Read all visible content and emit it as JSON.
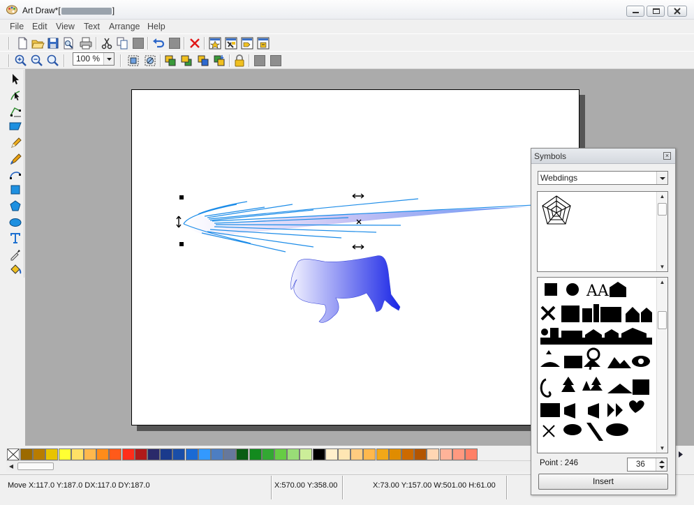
{
  "window": {
    "title": "Art Draw*[",
    "title_suffix": "]",
    "controls": [
      "minimize",
      "maximize",
      "close"
    ]
  },
  "menu": [
    "File",
    "Edit",
    "View",
    "Text",
    "Arrange",
    "Help"
  ],
  "toolbar1": {
    "buttons": [
      "new-icon",
      "open-icon",
      "save-icon",
      "print-preview-icon",
      "print-icon",
      "cut-icon",
      "copy-icon",
      "paste-icon",
      "undo-icon",
      "redo-icon",
      "delete-icon",
      "symbol-a-icon",
      "symbol-b-icon",
      "symbol-c-icon",
      "symbol-d-icon"
    ]
  },
  "toolbar2": {
    "buttons": [
      "zoom-in-icon",
      "zoom-out-icon",
      "zoom-actual-icon"
    ],
    "zoom_value": "100 %",
    "arrange_buttons": [
      "group-icon",
      "ungroup-icon",
      "bring-front-icon",
      "send-back-icon",
      "bring-forward-icon",
      "send-backward-icon",
      "lock-icon",
      "align-a-icon",
      "align-b-icon"
    ]
  },
  "tools": [
    "pointer-tool",
    "node-edit-tool",
    "crop-tool",
    "parallelogram-tool",
    "pencil-tool",
    "pen-tool",
    "bezier-tool",
    "rectangle-tool",
    "polygon-tool",
    "ellipse-tool",
    "text-tool",
    "color-picker-tool",
    "paint-bucket-tool"
  ],
  "palette": {
    "colors": [
      "#9c6a00",
      "#b87c00",
      "#e8c400",
      "#ffff33",
      "#ffe066",
      "#ffb84d",
      "#ff8c1a",
      "#ff5a1a",
      "#ff2d1a",
      "#b01a1a",
      "#2a2a6a",
      "#1a3a8c",
      "#1a4ea8",
      "#1a6ad4",
      "#3399ff",
      "#4d7ec2",
      "#66789c",
      "#0a5c14",
      "#138a1e",
      "#33a833",
      "#66cc44",
      "#99dd77",
      "#ccee99",
      "#000000",
      "#fff0cc",
      "#ffe6b3",
      "#ffcc80",
      "#ffb84d",
      "#f2a818",
      "#e08c00",
      "#cc6a00",
      "#b35500",
      "#ffd6b3",
      "#ffb399",
      "#ff9980",
      "#ff8066"
    ]
  },
  "status": {
    "left": "Move X:117.0 Y:187.0 DX:117.0 DY:187.0",
    "mid": "X:570.00 Y:358.00",
    "right": "X:73.00 Y:157.00  W:501.00  H:61.00"
  },
  "symbols_panel": {
    "title": "Symbols",
    "close_glyph": "×",
    "font": "Webdings",
    "point_label": "Point : 246",
    "size_value": "36",
    "insert_label": "Insert"
  }
}
